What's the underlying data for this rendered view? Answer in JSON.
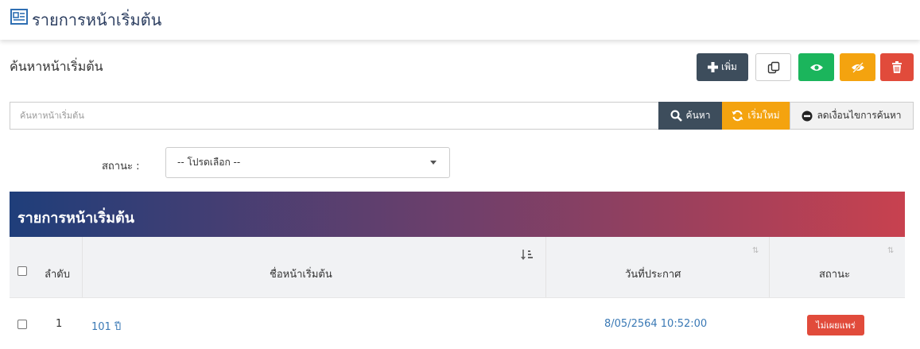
{
  "header": {
    "title": "รายการหน้าเริ่มต้น",
    "icon": "list-box-icon"
  },
  "search_section": {
    "title": "ค้นหาหน้าเริ่มต้น"
  },
  "toolbar": {
    "add_label": "เพิ่ม",
    "copy_icon": "copy-icon",
    "show_icon": "eye-icon",
    "hide_icon": "eye-slash-icon",
    "delete_icon": "trash-icon"
  },
  "search": {
    "placeholder": "ค้นหาหน้าเริ่มต้น",
    "search_label": "ค้นหา",
    "reset_label": "เริ่มใหม่",
    "reduce_label": "ลดเงื่อนไขการค้นหา"
  },
  "filters": {
    "status_label": "สถานะ :",
    "status_value": "-- โปรดเลือก --"
  },
  "table": {
    "title": "รายการหน้าเริ่มต้น",
    "columns": {
      "order": "ลำดับ",
      "name": "ชื่อหน้าเริ่มต้น",
      "date": "วันที่ประกาศ",
      "status": "สถานะ"
    },
    "rows": [
      {
        "order": "1",
        "name": "101 ปี",
        "date": "8/05/2564 10:52:00",
        "status": "ไม่เผยแพร่"
      }
    ]
  },
  "colors": {
    "accent": "#3d4d5c",
    "show": "#1bb55c",
    "hide": "#f4a30f",
    "delete": "#e14b3b",
    "link": "#3a79b5"
  }
}
